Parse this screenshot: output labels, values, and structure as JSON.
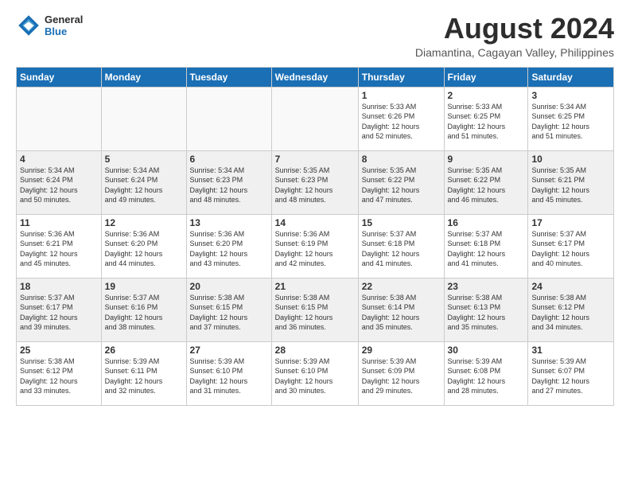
{
  "logo": {
    "general": "General",
    "blue": "Blue"
  },
  "title": {
    "month_year": "August 2024",
    "location": "Diamantina, Cagayan Valley, Philippines"
  },
  "headers": [
    "Sunday",
    "Monday",
    "Tuesday",
    "Wednesday",
    "Thursday",
    "Friday",
    "Saturday"
  ],
  "weeks": [
    {
      "shaded": false,
      "days": [
        {
          "num": "",
          "info": ""
        },
        {
          "num": "",
          "info": ""
        },
        {
          "num": "",
          "info": ""
        },
        {
          "num": "",
          "info": ""
        },
        {
          "num": "1",
          "info": "Sunrise: 5:33 AM\nSunset: 6:26 PM\nDaylight: 12 hours\nand 52 minutes."
        },
        {
          "num": "2",
          "info": "Sunrise: 5:33 AM\nSunset: 6:25 PM\nDaylight: 12 hours\nand 51 minutes."
        },
        {
          "num": "3",
          "info": "Sunrise: 5:34 AM\nSunset: 6:25 PM\nDaylight: 12 hours\nand 51 minutes."
        }
      ]
    },
    {
      "shaded": true,
      "days": [
        {
          "num": "4",
          "info": "Sunrise: 5:34 AM\nSunset: 6:24 PM\nDaylight: 12 hours\nand 50 minutes."
        },
        {
          "num": "5",
          "info": "Sunrise: 5:34 AM\nSunset: 6:24 PM\nDaylight: 12 hours\nand 49 minutes."
        },
        {
          "num": "6",
          "info": "Sunrise: 5:34 AM\nSunset: 6:23 PM\nDaylight: 12 hours\nand 48 minutes."
        },
        {
          "num": "7",
          "info": "Sunrise: 5:35 AM\nSunset: 6:23 PM\nDaylight: 12 hours\nand 48 minutes."
        },
        {
          "num": "8",
          "info": "Sunrise: 5:35 AM\nSunset: 6:22 PM\nDaylight: 12 hours\nand 47 minutes."
        },
        {
          "num": "9",
          "info": "Sunrise: 5:35 AM\nSunset: 6:22 PM\nDaylight: 12 hours\nand 46 minutes."
        },
        {
          "num": "10",
          "info": "Sunrise: 5:35 AM\nSunset: 6:21 PM\nDaylight: 12 hours\nand 45 minutes."
        }
      ]
    },
    {
      "shaded": false,
      "days": [
        {
          "num": "11",
          "info": "Sunrise: 5:36 AM\nSunset: 6:21 PM\nDaylight: 12 hours\nand 45 minutes."
        },
        {
          "num": "12",
          "info": "Sunrise: 5:36 AM\nSunset: 6:20 PM\nDaylight: 12 hours\nand 44 minutes."
        },
        {
          "num": "13",
          "info": "Sunrise: 5:36 AM\nSunset: 6:20 PM\nDaylight: 12 hours\nand 43 minutes."
        },
        {
          "num": "14",
          "info": "Sunrise: 5:36 AM\nSunset: 6:19 PM\nDaylight: 12 hours\nand 42 minutes."
        },
        {
          "num": "15",
          "info": "Sunrise: 5:37 AM\nSunset: 6:18 PM\nDaylight: 12 hours\nand 41 minutes."
        },
        {
          "num": "16",
          "info": "Sunrise: 5:37 AM\nSunset: 6:18 PM\nDaylight: 12 hours\nand 41 minutes."
        },
        {
          "num": "17",
          "info": "Sunrise: 5:37 AM\nSunset: 6:17 PM\nDaylight: 12 hours\nand 40 minutes."
        }
      ]
    },
    {
      "shaded": true,
      "days": [
        {
          "num": "18",
          "info": "Sunrise: 5:37 AM\nSunset: 6:17 PM\nDaylight: 12 hours\nand 39 minutes."
        },
        {
          "num": "19",
          "info": "Sunrise: 5:37 AM\nSunset: 6:16 PM\nDaylight: 12 hours\nand 38 minutes."
        },
        {
          "num": "20",
          "info": "Sunrise: 5:38 AM\nSunset: 6:15 PM\nDaylight: 12 hours\nand 37 minutes."
        },
        {
          "num": "21",
          "info": "Sunrise: 5:38 AM\nSunset: 6:15 PM\nDaylight: 12 hours\nand 36 minutes."
        },
        {
          "num": "22",
          "info": "Sunrise: 5:38 AM\nSunset: 6:14 PM\nDaylight: 12 hours\nand 35 minutes."
        },
        {
          "num": "23",
          "info": "Sunrise: 5:38 AM\nSunset: 6:13 PM\nDaylight: 12 hours\nand 35 minutes."
        },
        {
          "num": "24",
          "info": "Sunrise: 5:38 AM\nSunset: 6:12 PM\nDaylight: 12 hours\nand 34 minutes."
        }
      ]
    },
    {
      "shaded": false,
      "days": [
        {
          "num": "25",
          "info": "Sunrise: 5:38 AM\nSunset: 6:12 PM\nDaylight: 12 hours\nand 33 minutes."
        },
        {
          "num": "26",
          "info": "Sunrise: 5:39 AM\nSunset: 6:11 PM\nDaylight: 12 hours\nand 32 minutes."
        },
        {
          "num": "27",
          "info": "Sunrise: 5:39 AM\nSunset: 6:10 PM\nDaylight: 12 hours\nand 31 minutes."
        },
        {
          "num": "28",
          "info": "Sunrise: 5:39 AM\nSunset: 6:10 PM\nDaylight: 12 hours\nand 30 minutes."
        },
        {
          "num": "29",
          "info": "Sunrise: 5:39 AM\nSunset: 6:09 PM\nDaylight: 12 hours\nand 29 minutes."
        },
        {
          "num": "30",
          "info": "Sunrise: 5:39 AM\nSunset: 6:08 PM\nDaylight: 12 hours\nand 28 minutes."
        },
        {
          "num": "31",
          "info": "Sunrise: 5:39 AM\nSunset: 6:07 PM\nDaylight: 12 hours\nand 27 minutes."
        }
      ]
    }
  ]
}
